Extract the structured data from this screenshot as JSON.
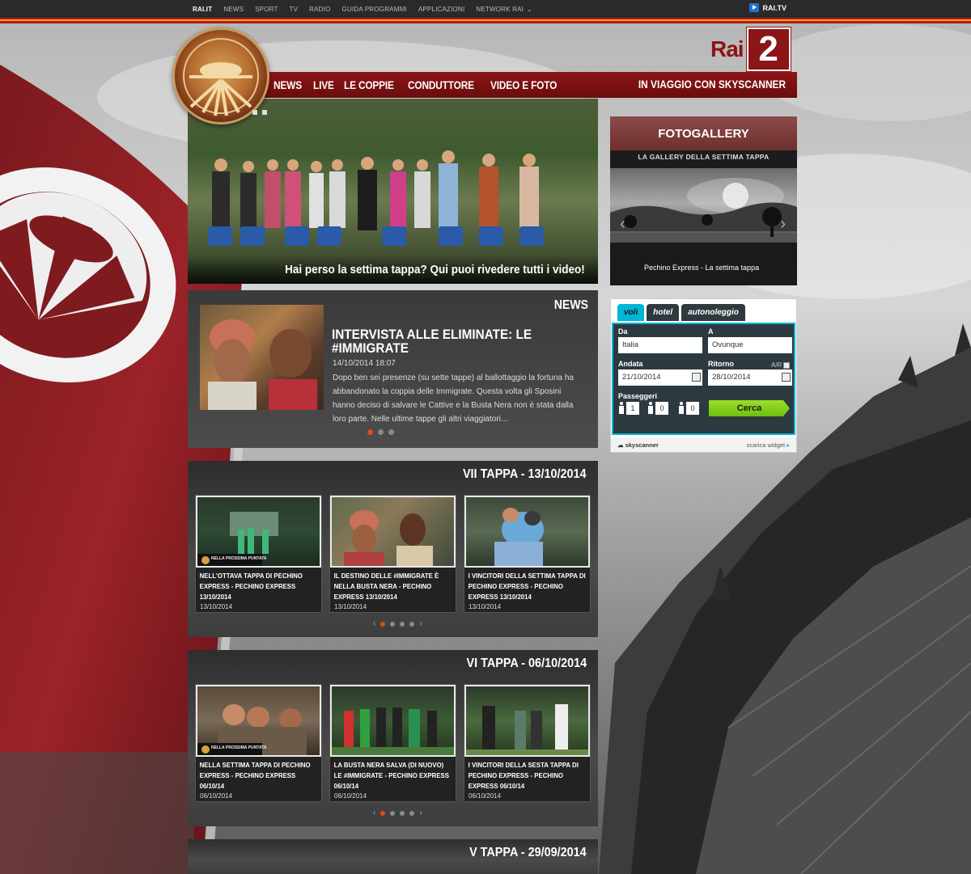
{
  "topbar": {
    "items": [
      "RAI.IT",
      "NEWS",
      "SPORT",
      "TV",
      "RADIO",
      "GUIDA PROGRAMMI",
      "APPLICAZIONI",
      "NETWORK RAI"
    ],
    "raitv": "RAI.TV"
  },
  "brand": {
    "rai": "Rai",
    "two": "2"
  },
  "mainnav": {
    "items": [
      "NEWS",
      "LIVE",
      "LE COPPIE",
      "CONDUTTORE",
      "VIDEO E FOTO"
    ],
    "right": "IN VIAGGIO CON SKYSCANNER"
  },
  "hero": {
    "caption": "Hai perso la settima tappa? Qui puoi rivedere tutti i video!"
  },
  "news": {
    "heading": "NEWS",
    "title": "INTERVISTA ALLE ELIMINATE: LE #IMMIGRATE",
    "date": "14/10/2014 18:07",
    "text": "Dopo ben sei presenze (su sette tappe) al ballottaggio la fortuna ha abbandonato la coppia delle Immigrate. Questa volta gli Sposini hanno deciso di salvare le Cattive e la Busta Nera non è stata dalla loro parte. Nelle ultime tappe gli altri viaggiatori..."
  },
  "tappe": [
    {
      "heading": "VII TAPPA - 13/10/2014",
      "cards": [
        {
          "title": "NELL'OTTAVA TAPPA DI PECHINO EXPRESS - PECHINO EXPRESS 13/10/2014",
          "date": "13/10/2014"
        },
        {
          "title": "IL DESTINO DELLE #IMMIGRATE È NELLA BUSTA NERA - PECHINO EXPRESS 13/10/2014",
          "date": "13/10/2014"
        },
        {
          "title": "I VINCITORI DELLA SETTIMA TAPPA DI PECHINO EXPRESS - PECHINO EXPRESS 13/10/2014",
          "date": "13/10/2014"
        }
      ]
    },
    {
      "heading": "VI TAPPA - 06/10/2014",
      "cards": [
        {
          "title": "NELLA SETTIMA TAPPA DI PECHINO EXPRESS - PECHINO EXPRESS 06/10/14",
          "date": "06/10/2014"
        },
        {
          "title": "LA BUSTA NERA SALVA (DI NUOVO) LE #IMMIGRATE - PECHINO EXPRESS 06/10/14",
          "date": "06/10/2014"
        },
        {
          "title": "I VINCITORI DELLA SESTA TAPPA DI PECHINO EXPRESS - PECHINO EXPRESS 06/10/14",
          "date": "06/10/2014"
        }
      ]
    },
    {
      "heading": "V TAPPA - 29/09/2014",
      "cards": []
    }
  ],
  "thumb_badge": "NELLA PROSSIMA PUNTATA",
  "fotogallery": {
    "heading": "FOTOGALLERY",
    "subtitle": "LA GALLERY DELLA SETTIMA TAPPA",
    "caption": "Pechino Express - La settima tappa"
  },
  "widget": {
    "tabs": [
      "voli",
      "hotel",
      "autonoleggio"
    ],
    "da_label": "Da",
    "da_value": "Italia",
    "a_label": "A",
    "a_value": "Ovunque",
    "andata_label": "Andata",
    "andata_value": "21/10/2014",
    "ritorno_label": "Ritorno",
    "ritorno_value": "28/10/2014",
    "ar_label": "A/R",
    "passeggeri_label": "Passeggeri",
    "adults": "1",
    "children": "0",
    "infants": "0",
    "cerca": "Cerca",
    "brand": "skyscanner",
    "scarica": "scarica widget"
  },
  "colors": {
    "brand_red": "#8b1517",
    "accent_orange": "#e64a14",
    "skyscanner_cyan": "#00b5d6",
    "cerca_green": "#7dcc16"
  }
}
